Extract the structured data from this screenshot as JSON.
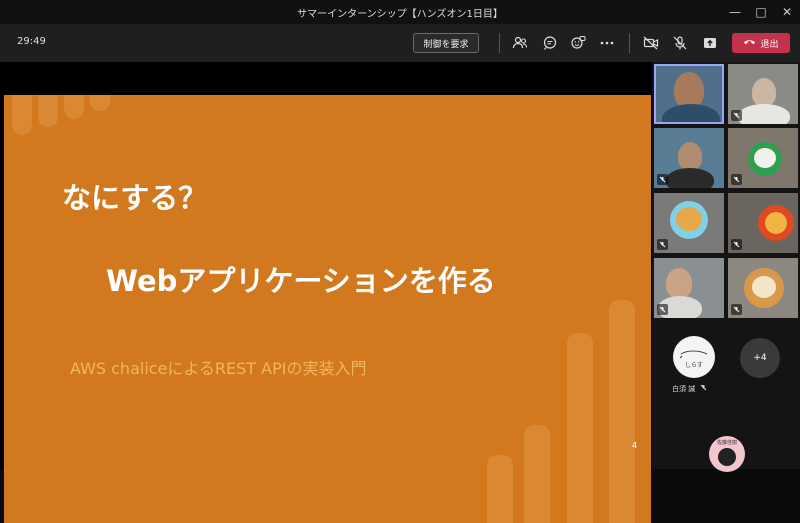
{
  "window": {
    "title": "サマーインターンシップ【ハンズオン1日目】"
  },
  "toolbar": {
    "timer": "29:49",
    "request_control_label": "制御を要求",
    "leave_label": "退出",
    "icons": [
      "people-icon",
      "chat-icon",
      "reactions-icon",
      "more-options-icon",
      "camera-off-icon",
      "mic-off-icon",
      "share-tray-icon",
      "phone-icon"
    ]
  },
  "slide": {
    "heading": "なにする？",
    "main_text": "Webアプリケーションを作る",
    "subtitle": "AWS chaliceによるREST APIの実装入門",
    "page_number": "4"
  },
  "participants": {
    "self_avatar_text": "しらす",
    "self_name": "白須 誠",
    "more_count": "+4",
    "bottom_avatar_label": "佐藤佳樹"
  },
  "colors": {
    "slide_bg": "#d2791f",
    "leave_button": "#c4314b",
    "active_speaker_border": "#9aa5f7"
  }
}
